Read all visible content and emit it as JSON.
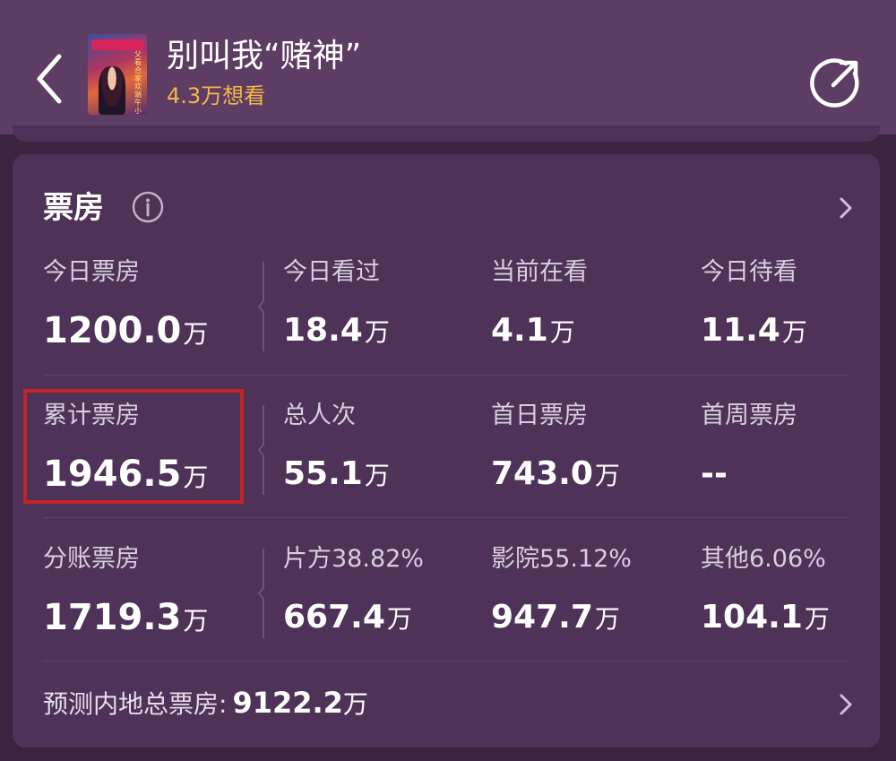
{
  "header": {
    "title": "别叫我“赌神”",
    "want_count": "4.3万想看",
    "poster_text": "父看合家欢端午小长假"
  },
  "box_office": {
    "title": "票房",
    "rows": [
      [
        {
          "label": "今日票房",
          "value": "1200.0",
          "unit": "万"
        },
        {
          "label": "今日看过",
          "value": "18.4",
          "unit": "万"
        },
        {
          "label": "当前在看",
          "value": "4.1",
          "unit": "万"
        },
        {
          "label": "今日待看",
          "value": "11.4",
          "unit": "万"
        }
      ],
      [
        {
          "label": "累计票房",
          "value": "1946.5",
          "unit": "万"
        },
        {
          "label": "总人次",
          "value": "55.1",
          "unit": "万"
        },
        {
          "label": "首日票房",
          "value": "743.0",
          "unit": "万"
        },
        {
          "label": "首周票房",
          "value": "--",
          "unit": ""
        }
      ],
      [
        {
          "label": "分账票房",
          "value": "1719.3",
          "unit": "万"
        },
        {
          "label": "片方38.82%",
          "value": "667.4",
          "unit": "万"
        },
        {
          "label": "影院55.12%",
          "value": "947.7",
          "unit": "万"
        },
        {
          "label": "其他6.06%",
          "value": "104.1",
          "unit": "万"
        }
      ]
    ],
    "forecast": {
      "label": "预测内地总票房:",
      "value": "9122.2",
      "unit": "万"
    }
  },
  "colors": {
    "header_bg": "#5d3d64",
    "card_bg": "#4e3257",
    "page_bg": "#3a2440",
    "want_text": "#f5b847",
    "highlight": "#c42424"
  },
  "icons": {
    "back": "back-arrow-icon",
    "share": "share-icon",
    "info": "info-icon",
    "chevron": "chevron-right-icon"
  }
}
